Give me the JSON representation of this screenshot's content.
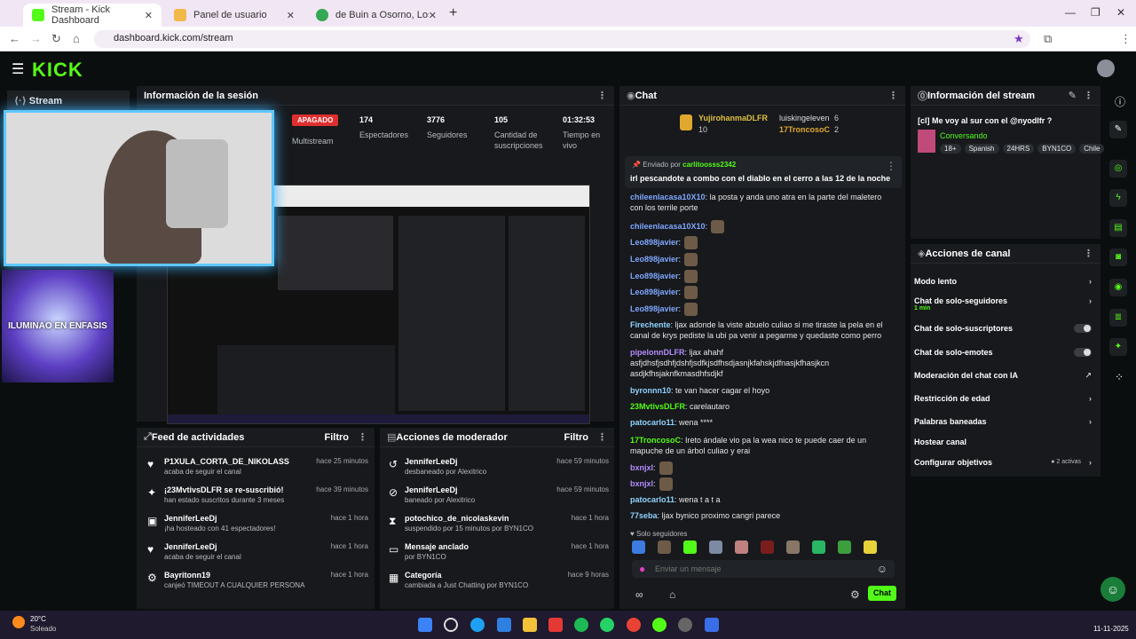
{
  "browser": {
    "tabs": [
      {
        "label": "Stream - Kick Dashboard",
        "active": true
      },
      {
        "label": "Panel de usuario",
        "active": false
      },
      {
        "label": "de Buin a Osorno, Los Lagos - G",
        "active": false
      }
    ],
    "url": "dashboard.kick.com/stream"
  },
  "kick": {
    "logo": "KICK",
    "nav_stream": "Stream"
  },
  "session": {
    "title": "Información de la sesión",
    "status_badge": "APAGADO",
    "multistream": "Multistream",
    "stats": [
      {
        "value": "174",
        "label": "Espectadores"
      },
      {
        "value": "3776",
        "label": "Seguidores"
      },
      {
        "value": "105",
        "label": "Cantidad de suscripciones"
      },
      {
        "value": "01:32:53",
        "label": "Tiempo en vivo"
      }
    ]
  },
  "overlay": {
    "caption": "ILUMINAO EN ENFASIS"
  },
  "chat": {
    "title": "Chat",
    "top_users": [
      {
        "name": "YujirohanmaDLFR",
        "count": "10"
      },
      {
        "name": "luiskingeleven",
        "count": "6"
      },
      {
        "name": "17TroncosoC",
        "count": "2"
      }
    ],
    "pinned_label": "Enviado por",
    "pinned_user": "carlitoosss2342",
    "pinned_message": "irl pescandote a combo con el diablo en el cerro a las 12 de la noche",
    "messages": [
      {
        "user": "chileenlacasa10X10",
        "text": ": la posta y anda uno atra en la parte del maletero con los terrile porte",
        "color": "#7fa7ff"
      },
      {
        "user": "chileenlacasa10X10",
        "text": ":",
        "color": "#7fa7ff"
      },
      {
        "user": "Leo898javier",
        "text": ":",
        "color": "#7fa7ff"
      },
      {
        "user": "Leo898javier",
        "text": ":",
        "color": "#7fa7ff"
      },
      {
        "user": "Leo898javier",
        "text": ":",
        "color": "#7fa7ff"
      },
      {
        "user": "Leo898javier",
        "text": ":",
        "color": "#7fa7ff"
      },
      {
        "user": "Leo898javier",
        "text": ":",
        "color": "#7fa7ff"
      },
      {
        "user": "Firechente",
        "text": ": ljax adonde la viste abuelo culiao si me tiraste la pela en el canal de krys pediste la ubi pa venir a pegarme y quedaste como perro",
        "color": "#8fd3ff"
      },
      {
        "user": "pipelonnDLFR",
        "text": ": ljax ahahf asfjdhsfjsdhfjdshfjsdfkjsdfhsdjasnjkfahskjdfnasjkfhasjkcn asdjkfhsjaknfkmasdhfsdjkf",
        "color": "#b48cff"
      },
      {
        "user": "byronnn10",
        "text": ": te van hacer cagar el hoyo",
        "color": "#8fd3ff"
      },
      {
        "user": "23MvtivsDLFR",
        "text": ": carelautaro",
        "color": "#53fc18"
      },
      {
        "user": "patocarlo11",
        "text": ": wena ****",
        "color": "#8fd3ff"
      },
      {
        "user": "17TroncosoC",
        "text": ": Ireto ándale vio pa la wea nico te puede caer de un mapuche de un árbol culiao y erai",
        "color": "#53fc18"
      },
      {
        "user": "bxnjxl",
        "text": ":",
        "color": "#b48cff"
      },
      {
        "user": "bxnjxl",
        "text": ":",
        "color": "#b48cff"
      },
      {
        "user": "patocarlo11",
        "text": ": wena t a t a",
        "color": "#8fd3ff"
      },
      {
        "user": "77seba",
        "text": ": ljax bynico proximo cangri parece",
        "color": "#8fd3ff"
      }
    ],
    "followers_only": "Solo seguidores",
    "input_placeholder": "Enviar un mensaje",
    "send_label": "Chat"
  },
  "activity": {
    "title": "Feed de actividades",
    "filter": "Filtro",
    "items": [
      {
        "user": "P1XULA_CORTA_DE_NIKOLASS",
        "desc": "acaba de seguir el canal",
        "time": "hace 25 minutos"
      },
      {
        "user": "¡23MvtivsDLFR se re-suscribió!",
        "desc": "han estado suscritos durante 3 meses",
        "time": "hace 39 minutos"
      },
      {
        "user": "JenniferLeeDj",
        "desc": "¡ha hosteado con 41 espectadores!",
        "time": "hace 1 hora"
      },
      {
        "user": "JenniferLeeDj",
        "desc": "acaba de seguir el canal",
        "time": "hace 1 hora"
      },
      {
        "user": "Bayritonn19",
        "desc": "canjeó TIMEOUT A CUALQUIER PERSONA",
        "time": "hace 1 hora"
      }
    ]
  },
  "mod": {
    "title": "Acciones de moderador",
    "filter": "Filtro",
    "items": [
      {
        "user": "JenniferLeeDj",
        "desc": "desbaneado por Alexitrico",
        "time": "hace 59 minutos"
      },
      {
        "user": "JenniferLeeDj",
        "desc": "baneado por Alexitrico",
        "time": "hace 59 minutos"
      },
      {
        "user": "potochico_de_nicolaskevin",
        "desc": "suspendido por 15 minutos por BYN1CO",
        "time": "hace 1 hora"
      },
      {
        "user": "Mensaje anclado",
        "desc": "por BYN1CO",
        "time": "hace 1 hora"
      },
      {
        "user": "Categoría",
        "desc": "cambiada a Just Chatting por BYN1CO",
        "time": "hace 9 horas"
      }
    ]
  },
  "stream_info": {
    "title": "Información del stream",
    "stream_title": "[cl] Me voy al sur con el @nyodlfr ?",
    "category": "Conversando",
    "tags": [
      "18+",
      "Spanish",
      "24HRS",
      "BYN1CO",
      "Chile"
    ]
  },
  "channel_actions": {
    "title": "Acciones de canal",
    "items": [
      {
        "label": "Modo lento",
        "sub": "",
        "control": "chevron"
      },
      {
        "label": "Chat de solo-seguidores",
        "sub": "1 min",
        "control": "chevron"
      },
      {
        "label": "Chat de solo-suscriptores",
        "sub": "",
        "control": "toggle"
      },
      {
        "label": "Chat de solo-emotes",
        "sub": "",
        "control": "toggle"
      },
      {
        "label": "Moderación del chat con IA",
        "sub": "",
        "control": "external"
      },
      {
        "label": "Restricción de edad",
        "sub": "",
        "control": "chevron"
      },
      {
        "label": "Palabras baneadas",
        "sub": "",
        "control": "chevron"
      },
      {
        "label": "Hostear canal",
        "sub": "",
        "control": "none"
      },
      {
        "label": "Configurar objetivos",
        "sub": "2 activas",
        "control": "chevron"
      }
    ]
  },
  "taskbar": {
    "weather_temp": "20°C",
    "weather_desc": "Soleado",
    "date": "11-11-2025"
  },
  "colors": {
    "kick_green": "#53fc18",
    "panel_bg": "#17191c",
    "badge_red": "#e02f2f"
  }
}
